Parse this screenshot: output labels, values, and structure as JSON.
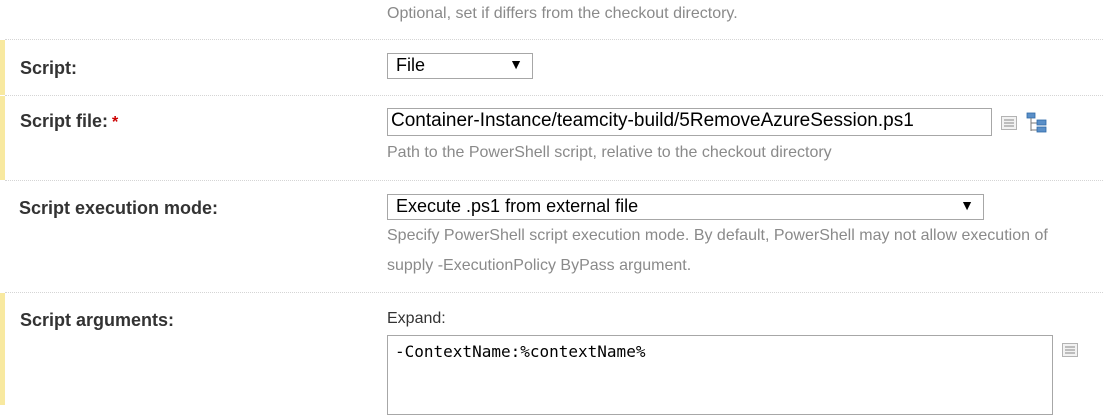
{
  "top_hint": "Optional, set if differs from the checkout directory.",
  "script": {
    "label": "Script:",
    "value": "File"
  },
  "script_file": {
    "label": "Script file:",
    "required_marker": "*",
    "value": "Container-Instance/teamcity-build/5RemoveAzureSession.ps1",
    "hint": "Path to the PowerShell script, relative to the checkout directory"
  },
  "execution_mode": {
    "label": "Script execution mode:",
    "value": "Execute .ps1 from external file",
    "hint_line1": "Specify PowerShell script execution mode. By default, PowerShell may not allow execution of",
    "hint_line2": "supply -ExecutionPolicy ByPass argument."
  },
  "script_arguments": {
    "label": "Script arguments:",
    "expand_label": "Expand:",
    "value": "-ContextName:%contextName%"
  },
  "icons": {
    "param_list": "parameters-list-icon",
    "file_tree": "file-tree-icon"
  },
  "colors": {
    "highlight_border": "#f8e9a0",
    "hint_text": "#8a8a8a",
    "required": "#cc0000"
  }
}
